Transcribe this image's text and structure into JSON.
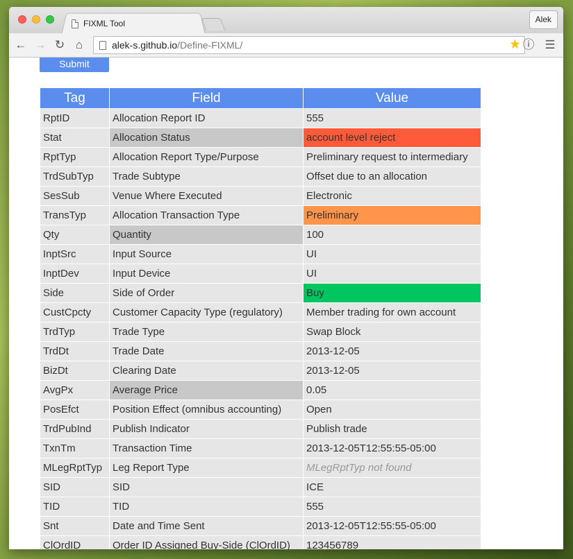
{
  "browser": {
    "tab_title": "FIXML Tool",
    "profile": "Alek",
    "url_host": "alek-s.github.io",
    "url_path": "/Define-FIXML/"
  },
  "page": {
    "submit_label": "Submit",
    "headers": {
      "tag": "Tag",
      "field": "Field",
      "value": "Value"
    },
    "colors": {
      "header": "#5b8dee",
      "cell": "#e6e6e6",
      "field_highlight": "#c8c8c8",
      "red": "#ff5b3a",
      "orange": "#ff954b",
      "green": "#00c660"
    },
    "rows": [
      {
        "tag": "RptID",
        "field": "Allocation Report ID",
        "value": "555"
      },
      {
        "tag": "Stat",
        "field": "Allocation Status",
        "value": "account level reject",
        "field_hl": true,
        "value_color": "red"
      },
      {
        "tag": "RptTyp",
        "field": "Allocation Report Type/Purpose",
        "value": "Preliminary request to intermediary"
      },
      {
        "tag": "TrdSubTyp",
        "field": "Trade Subtype",
        "value": "Offset due to an allocation"
      },
      {
        "tag": "SesSub",
        "field": "Venue Where Executed",
        "value": "Electronic"
      },
      {
        "tag": "TransTyp",
        "field": "Allocation Transaction Type",
        "value": "Preliminary",
        "value_color": "orange"
      },
      {
        "tag": "Qty",
        "field": "Quantity",
        "value": "100",
        "field_hl": true
      },
      {
        "tag": "InptSrc",
        "field": "Input Source",
        "value": "UI"
      },
      {
        "tag": "InptDev",
        "field": "Input Device",
        "value": "UI"
      },
      {
        "tag": "Side",
        "field": "Side of Order",
        "value": "Buy",
        "value_color": "green"
      },
      {
        "tag": "CustCpcty",
        "field": "Customer Capacity Type (regulatory)",
        "value": "Member trading for own account"
      },
      {
        "tag": "TrdTyp",
        "field": "Trade Type",
        "value": "Swap Block"
      },
      {
        "tag": "TrdDt",
        "field": "Trade Date",
        "value": "2013-12-05"
      },
      {
        "tag": "BizDt",
        "field": "Clearing Date",
        "value": "2013-12-05"
      },
      {
        "tag": "AvgPx",
        "field": "Average Price",
        "value": "0.05",
        "field_hl": true
      },
      {
        "tag": "PosEfct",
        "field": "Position Effect (omnibus accounting)",
        "value": "Open"
      },
      {
        "tag": "TrdPubInd",
        "field": "Publish Indicator",
        "value": "Publish trade"
      },
      {
        "tag": "TxnTm",
        "field": "Transaction Time",
        "value": "2013-12-05T12:55:55-05:00"
      },
      {
        "tag": "MLegRptTyp",
        "field": "Leg Report Type",
        "value": "MLegRptTyp not found",
        "not_found": true
      },
      {
        "tag": "SID",
        "field": "SID",
        "value": "ICE"
      },
      {
        "tag": "TID",
        "field": "TID",
        "value": "555"
      },
      {
        "tag": "Snt",
        "field": "Date and Time Sent",
        "value": "2013-12-05T12:55:55-05:00"
      },
      {
        "tag": "ClOrdID",
        "field": "Order ID Assigned Buy-Side (ClOrdID)",
        "value": "123456789"
      }
    ]
  }
}
